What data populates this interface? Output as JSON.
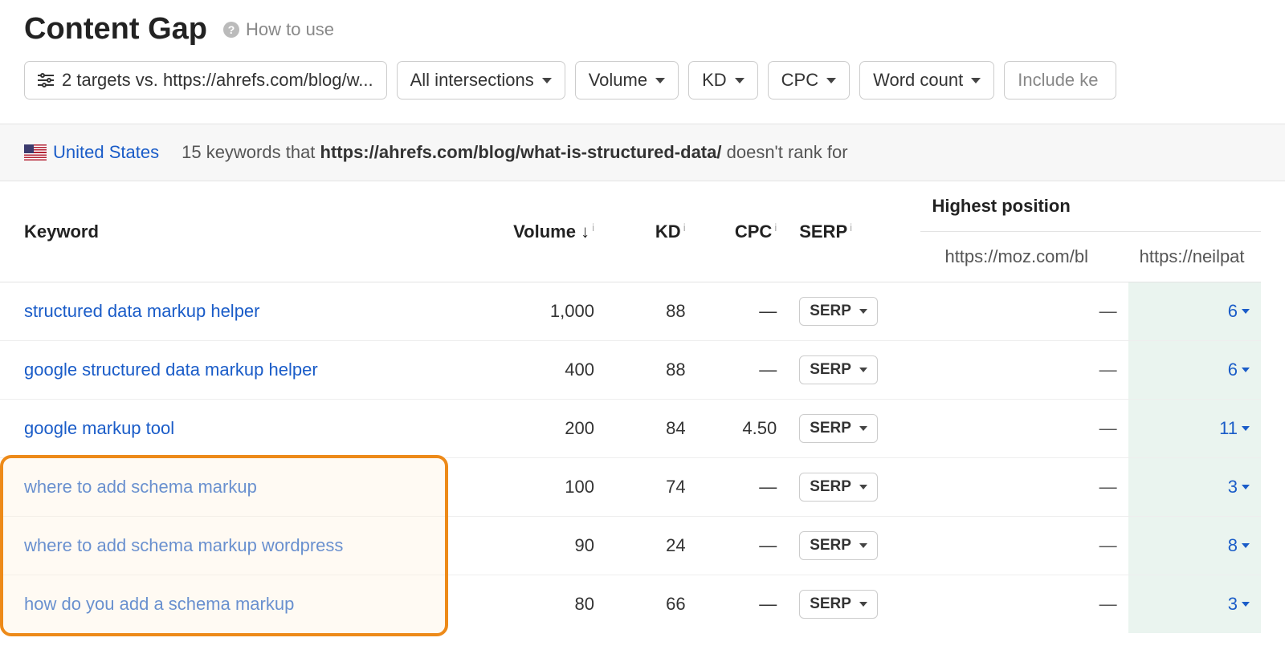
{
  "header": {
    "title": "Content Gap",
    "how_to_use": "How to use"
  },
  "filters": {
    "targets": "2 targets vs. https://ahrefs.com/blog/w...",
    "intersections": "All intersections",
    "volume": "Volume",
    "kd": "KD",
    "cpc": "CPC",
    "word_count": "Word count",
    "include_placeholder": "Include ke"
  },
  "summary": {
    "country": "United States",
    "count": "15",
    "mid": "keywords that",
    "url_bold": "https://ahrefs.com/blog/what-is-structured-data/",
    "tail": "doesn't rank for"
  },
  "columns": {
    "keyword": "Keyword",
    "volume": "Volume",
    "kd": "KD",
    "cpc": "CPC",
    "serp": "SERP",
    "highest_position": "Highest position",
    "pos_col1": "https://moz.com/bl",
    "pos_col2": "https://neilpat"
  },
  "serp_label": "SERP",
  "rows": [
    {
      "keyword": "structured data markup helper",
      "volume": "1,000",
      "kd": "88",
      "cpc": "—",
      "p1": "—",
      "p2": "6",
      "hl": false
    },
    {
      "keyword": "google structured data markup helper",
      "volume": "400",
      "kd": "88",
      "cpc": "—",
      "p1": "—",
      "p2": "6",
      "hl": false
    },
    {
      "keyword": "google markup tool",
      "volume": "200",
      "kd": "84",
      "cpc": "4.50",
      "p1": "—",
      "p2": "11",
      "hl": false
    },
    {
      "keyword": "where to add schema markup",
      "volume": "100",
      "kd": "74",
      "cpc": "—",
      "p1": "—",
      "p2": "3",
      "hl": true
    },
    {
      "keyword": "where to add schema markup wordpress",
      "volume": "90",
      "kd": "24",
      "cpc": "—",
      "p1": "—",
      "p2": "8",
      "hl": true
    },
    {
      "keyword": "how do you add a schema markup",
      "volume": "80",
      "kd": "66",
      "cpc": "—",
      "p1": "—",
      "p2": "3",
      "hl": true
    }
  ]
}
